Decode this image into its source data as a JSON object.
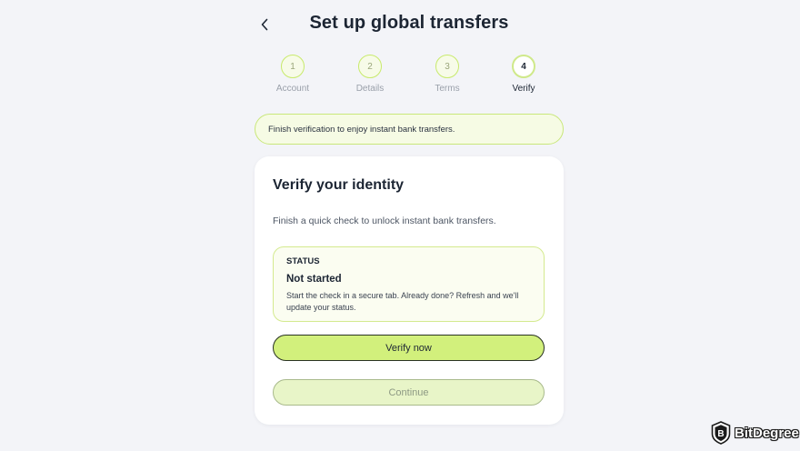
{
  "header": {
    "title": "Set up global transfers"
  },
  "stepper": {
    "steps": [
      {
        "number": "1",
        "label": "Account"
      },
      {
        "number": "2",
        "label": "Details"
      },
      {
        "number": "3",
        "label": "Terms"
      },
      {
        "number": "4",
        "label": "Verify"
      }
    ],
    "active_step": 4
  },
  "banner": {
    "text": "Finish verification to enjoy instant bank transfers."
  },
  "card": {
    "title": "Verify your identity",
    "subtitle": "Finish a quick check to unlock instant bank transfers.",
    "status": {
      "eyebrow": "STATUS",
      "value": "Not started",
      "description": "Start the check in a secure tab. Already done? Refresh and we'll update your status."
    },
    "primary_button": "Verify now",
    "secondary_button": "Continue"
  },
  "watermark": {
    "text": "BitDegree",
    "logo_letter": "B"
  },
  "colors": {
    "accent": "#d2f07c",
    "accent_border": "#c9e77a",
    "background": "#f3f4f8",
    "text": "#1c2533"
  }
}
